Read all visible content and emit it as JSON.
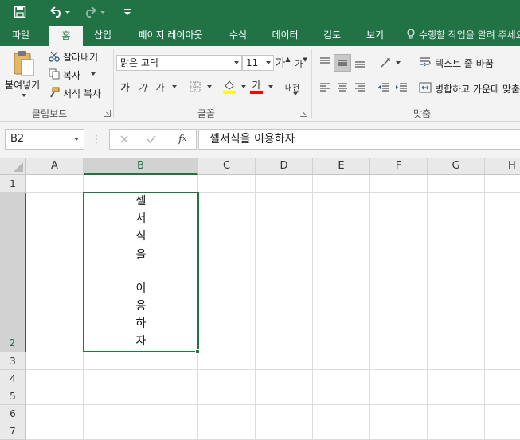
{
  "tabs": [
    "파일",
    "홈",
    "삽입",
    "페이지 레이아웃",
    "수식",
    "데이터",
    "검토",
    "보기"
  ],
  "active_tab": "홈",
  "tell_me": "수행할 작업을 알려 주세요",
  "clipboard": {
    "paste": "붙여넣기",
    "cut": "잘라내기",
    "copy": "복사",
    "format_painter": "서식 복사",
    "group": "클립보드"
  },
  "font": {
    "name": "맑은 고딕",
    "size": "11",
    "grow": "가",
    "shrink": "가",
    "bold": "가",
    "italic": "가",
    "underline": "가",
    "font_color": "가",
    "phonetic": "내천",
    "group": "글꼴",
    "highlight_color": "#ffff00",
    "font_color_swatch": "#ff0000"
  },
  "alignment": {
    "wrap_text": "텍스트 줄 바꿈",
    "merge_center": "병합하고 가운데 맞춤",
    "group": "맞춤"
  },
  "name_box": "B2",
  "formula": "셀서식을 이용하자",
  "columns": [
    "A",
    "B",
    "C",
    "D",
    "E",
    "F",
    "G",
    "H"
  ],
  "rows": [
    "1",
    "2",
    "3",
    "4",
    "5",
    "6",
    "7"
  ],
  "selected_column": "B",
  "selected_row": "2",
  "cell_b2_lines": [
    "셀",
    "서",
    "식",
    "을",
    "",
    "이",
    "용",
    "하",
    "자"
  ],
  "colors": {
    "accent": "#217346"
  }
}
